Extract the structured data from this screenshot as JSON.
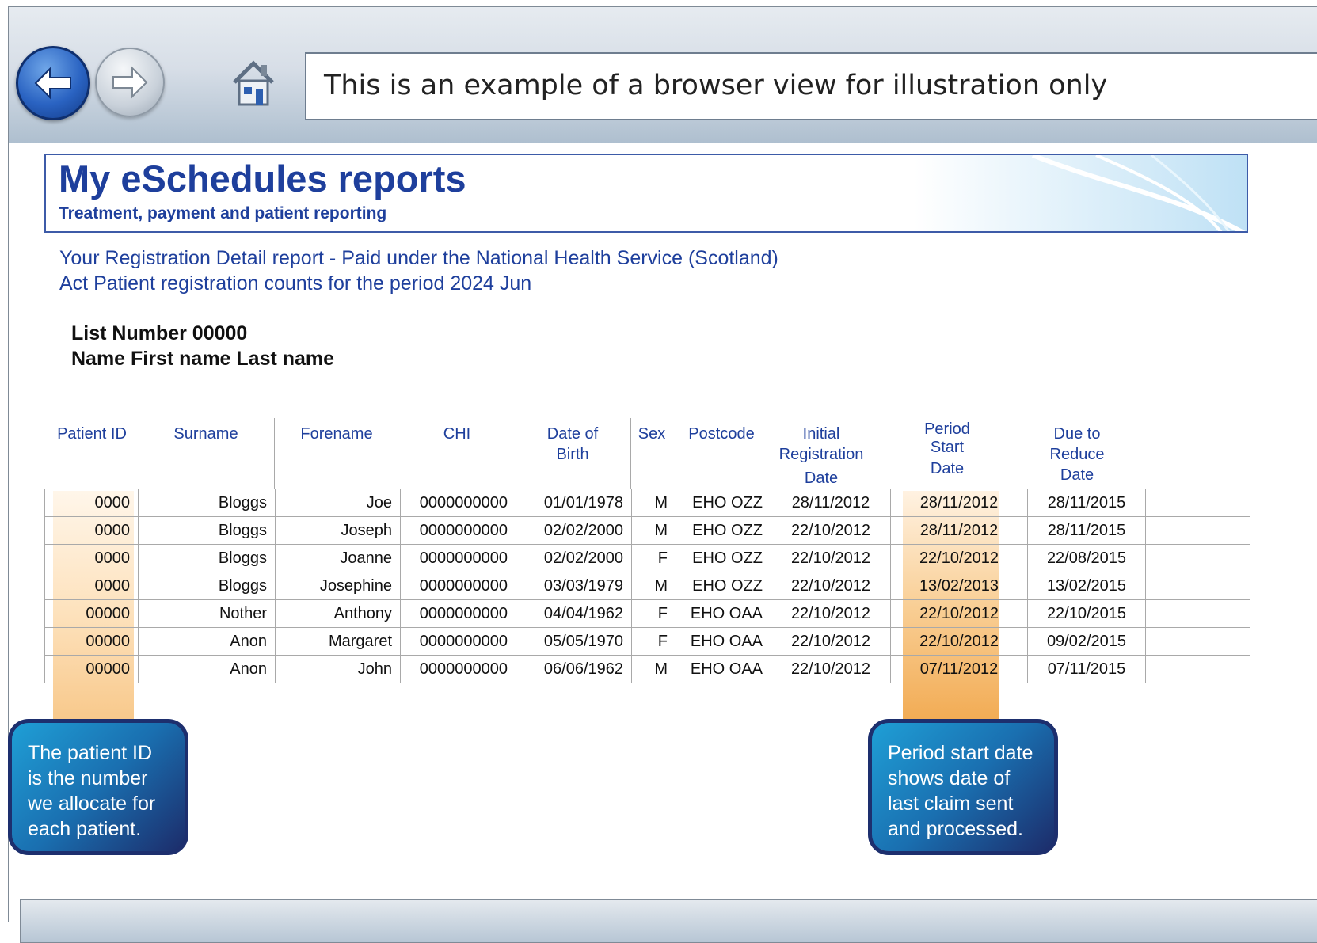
{
  "browser": {
    "address_text": "This is an example of a browser view for illustration only",
    "back_icon": "back-arrow-icon",
    "forward_icon": "forward-arrow-icon",
    "home_icon": "home-icon"
  },
  "banner": {
    "title": "My eSchedules reports",
    "subtitle": "Treatment, payment and patient reporting"
  },
  "report": {
    "line1": "Your Registration Detail report - Paid under the National Health Service (Scotland)",
    "line2": "Act Patient registration counts for the period 2024 Jun"
  },
  "list": {
    "number": "List Number 00000",
    "name": "Name First name Last name"
  },
  "table": {
    "headers": {
      "patient_id": "Patient ID",
      "surname": "Surname",
      "forename": "Forename",
      "chi": "CHI",
      "dob_1": "Date of",
      "dob_2": "Birth",
      "sex": "Sex",
      "postcode": "Postcode",
      "initial_1": "Initial",
      "initial_2": "Registration",
      "initial_3": "Date",
      "period_1": "Period",
      "period_2": "Start",
      "period_3": "Date",
      "due_1": "Due to",
      "due_2": "Reduce",
      "due_3": "Date"
    },
    "rows": [
      {
        "id": "0000",
        "surname": "Bloggs",
        "forename": "Joe",
        "chi": "0000000000",
        "dob": "01/01/1978",
        "sex": "M",
        "postcode": "EHO OZZ",
        "initial": "28/11/2012",
        "period": "28/11/2012",
        "due": "28/11/2015"
      },
      {
        "id": "0000",
        "surname": "Bloggs",
        "forename": "Joseph",
        "chi": "0000000000",
        "dob": "02/02/2000",
        "sex": "M",
        "postcode": "EHO OZZ",
        "initial": "22/10/2012",
        "period": "28/11/2012",
        "due": "28/11/2015"
      },
      {
        "id": "0000",
        "surname": "Bloggs",
        "forename": "Joanne",
        "chi": "0000000000",
        "dob": "02/02/2000",
        "sex": "F",
        "postcode": "EHO OZZ",
        "initial": "22/10/2012",
        "period": "22/10/2012",
        "due": "22/08/2015"
      },
      {
        "id": "0000",
        "surname": "Bloggs",
        "forename": "Josephine",
        "chi": "0000000000",
        "dob": "03/03/1979",
        "sex": "M",
        "postcode": "EHO OZZ",
        "initial": "22/10/2012",
        "period": "13/02/2013",
        "due": "13/02/2015"
      },
      {
        "id": "00000",
        "surname": "Nother",
        "forename": "Anthony",
        "chi": "0000000000",
        "dob": "04/04/1962",
        "sex": "F",
        "postcode": "EHO OAA",
        "initial": "22/10/2012",
        "period": "22/10/2012",
        "due": "22/10/2015"
      },
      {
        "id": "00000",
        "surname": "Anon",
        "forename": "Margaret",
        "chi": "0000000000",
        "dob": "05/05/1970",
        "sex": "F",
        "postcode": "EHO OAA",
        "initial": "22/10/2012",
        "period": "22/10/2012",
        "due": "09/02/2015"
      },
      {
        "id": "00000",
        "surname": "Anon",
        "forename": "John",
        "chi": "0000000000",
        "dob": "06/06/1962",
        "sex": "M",
        "postcode": "EHO OAA",
        "initial": "22/10/2012",
        "period": "07/11/2012",
        "due": "07/11/2015"
      }
    ]
  },
  "callouts": {
    "patient_id": "The patient ID is the number we allocate for each patient.",
    "period_start": "Period start date shows date of last claim sent and processed."
  },
  "colors": {
    "heading_blue": "#1e3f9c",
    "highlight_orange": "#f2ac55",
    "callout_blue": "#1a6fb0"
  }
}
